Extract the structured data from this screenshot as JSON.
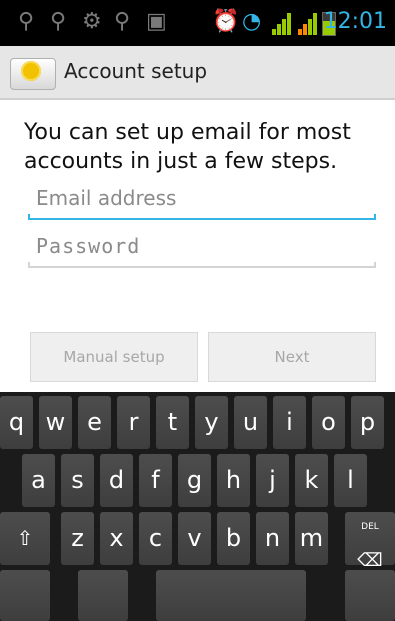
{
  "status_bar": {
    "time": "12:01",
    "icons": [
      "usb-icon",
      "usb-icon",
      "android-icon",
      "usb-icon",
      "image-icon",
      "alarm-icon",
      "wifi-icon",
      "signal-icon",
      "signal-icon",
      "battery-icon"
    ]
  },
  "header": {
    "title": "Account setup"
  },
  "main": {
    "intro": "You can set up email for most accounts in just a few steps.",
    "email_placeholder": "Email address",
    "password_placeholder": "Password",
    "manual_setup_label": "Manual setup",
    "next_label": "Next"
  },
  "keyboard": {
    "row1": [
      "q",
      "w",
      "e",
      "r",
      "t",
      "y",
      "u",
      "i",
      "o",
      "p"
    ],
    "row2": [
      "a",
      "s",
      "d",
      "f",
      "g",
      "h",
      "j",
      "k",
      "l"
    ],
    "row3": [
      "z",
      "x",
      "c",
      "v",
      "b",
      "n",
      "m"
    ],
    "shift_symbol": "⇧",
    "delete_label": "DEL",
    "delete_symbol": "⌫"
  }
}
